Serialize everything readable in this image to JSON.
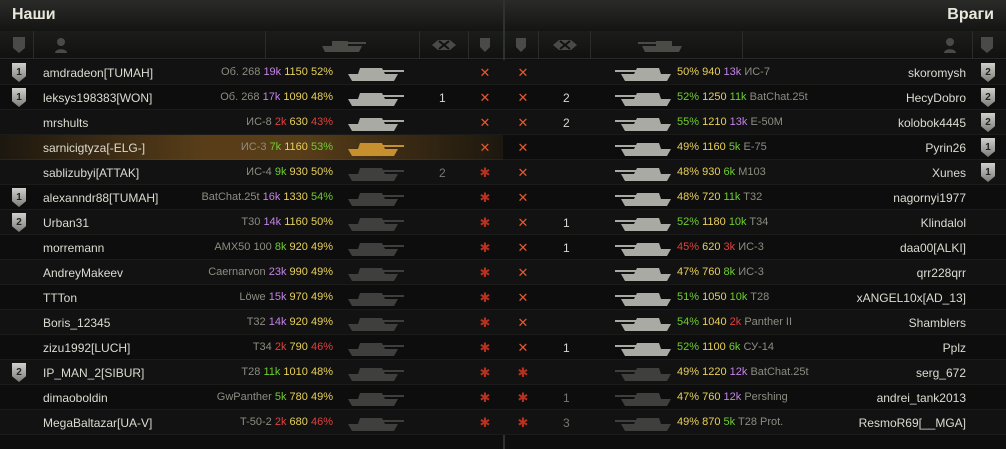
{
  "teams": {
    "left_title": "Наши",
    "right_title": "Враги"
  },
  "colors": {
    "win_green": "#6fce2f",
    "ok_yellow": "#e9d05a",
    "bad_red": "#e04040",
    "unicum_purple": "#c583e8",
    "highlight_gold": "#96642a"
  },
  "header_icons": [
    "badge-column-icon",
    "player-column-icon",
    "tank-column-icon",
    "frags-column-icon",
    "status-column-icon"
  ],
  "left": [
    {
      "badge": "1",
      "name": "amdradeon[TUMAH]",
      "tank": "Об. 268",
      "battles": "19k",
      "wn": "1150",
      "win": "52%",
      "bc": "c-purple",
      "wc": "c-yellow",
      "frags": "",
      "status": "x",
      "highlight": false,
      "dim": false
    },
    {
      "badge": "1",
      "name": "leksys198383[WON]",
      "tank": "Об. 268",
      "battles": "17k",
      "wn": "1090",
      "win": "48%",
      "bc": "c-purple",
      "wc": "c-yellow",
      "frags": "1",
      "status": "x",
      "highlight": false,
      "dim": false
    },
    {
      "badge": "",
      "name": "mrshults",
      "tank": "ИС-8",
      "battles": "2k",
      "wn": "630",
      "win": "43%",
      "bc": "c-red",
      "wc": "c-red",
      "frags": "",
      "status": "x",
      "highlight": false,
      "dim": false
    },
    {
      "badge": "",
      "name": "sarnicigtyza[-ELG-]",
      "tank": "ИС-3",
      "battles": "7k",
      "wn": "1160",
      "win": "53%",
      "bc": "c-green",
      "wc": "c-green",
      "frags": "",
      "status": "x",
      "highlight": true,
      "dim": false
    },
    {
      "badge": "",
      "name": "sablizubyi[ATTAK]",
      "tank": "ИС-4",
      "battles": "9k",
      "wn": "930",
      "win": "50%",
      "bc": "c-green",
      "wc": "c-yellow",
      "frags": "2",
      "status": "alive",
      "highlight": false,
      "dim": true
    },
    {
      "badge": "1",
      "name": "alexanndr88[TUMAH]",
      "tank": "BatChat.25t",
      "battles": "16k",
      "wn": "1330",
      "win": "54%",
      "bc": "c-purple",
      "wc": "c-green",
      "frags": "",
      "status": "alive",
      "highlight": false,
      "dim": false
    },
    {
      "badge": "2",
      "name": "Urban31",
      "tank": "T30",
      "battles": "14k",
      "wn": "1160",
      "win": "50%",
      "bc": "c-purple",
      "wc": "c-yellow",
      "frags": "",
      "status": "alive",
      "highlight": false,
      "dim": false
    },
    {
      "badge": "",
      "name": "morremann",
      "tank": "AMX50 100",
      "battles": "8k",
      "wn": "920",
      "win": "49%",
      "bc": "c-green",
      "wc": "c-yellow",
      "frags": "",
      "status": "alive",
      "highlight": false,
      "dim": false
    },
    {
      "badge": "",
      "name": "AndreyMakeev",
      "tank": "Caernarvon",
      "battles": "23k",
      "wn": "990",
      "win": "49%",
      "bc": "c-purple",
      "wc": "c-yellow",
      "frags": "",
      "status": "alive",
      "highlight": false,
      "dim": false
    },
    {
      "badge": "",
      "name": "TTTon",
      "tank": "Löwe",
      "battles": "15k",
      "wn": "970",
      "win": "49%",
      "bc": "c-purple",
      "wc": "c-yellow",
      "frags": "",
      "status": "alive",
      "highlight": false,
      "dim": false
    },
    {
      "badge": "",
      "name": "Boris_12345",
      "tank": "T32",
      "battles": "14k",
      "wn": "920",
      "win": "49%",
      "bc": "c-purple",
      "wc": "c-yellow",
      "frags": "",
      "status": "alive",
      "highlight": false,
      "dim": false
    },
    {
      "badge": "",
      "name": "zizu1992[LUCH]",
      "tank": "T34",
      "battles": "2k",
      "wn": "790",
      "win": "46%",
      "bc": "c-red",
      "wc": "c-red",
      "frags": "",
      "status": "alive",
      "highlight": false,
      "dim": false
    },
    {
      "badge": "2",
      "name": "IP_MAN_2[SIBUR]",
      "tank": "T28",
      "battles": "11k",
      "wn": "1010",
      "win": "48%",
      "bc": "c-green",
      "wc": "c-yellow",
      "frags": "",
      "status": "alive",
      "highlight": false,
      "dim": false
    },
    {
      "badge": "",
      "name": "dimaoboldin",
      "tank": "GwPanther",
      "battles": "5k",
      "wn": "780",
      "win": "49%",
      "bc": "c-green",
      "wc": "c-yellow",
      "frags": "",
      "status": "alive",
      "highlight": false,
      "dim": false
    },
    {
      "badge": "",
      "name": "MegaBaltazar[UA-V]",
      "tank": "T-50-2",
      "battles": "2k",
      "wn": "680",
      "win": "46%",
      "bc": "c-red",
      "wc": "c-red",
      "frags": "",
      "status": "alive",
      "highlight": false,
      "dim": false
    }
  ],
  "right": [
    {
      "badge": "2",
      "name": "skoromysh",
      "tank": "ИС-7",
      "battles": "13k",
      "wn": "940",
      "win": "50%",
      "bc": "c-purple",
      "wc": "c-yellow",
      "frags": "",
      "status": "x"
    },
    {
      "badge": "2",
      "name": "HecyDobro",
      "tank": "BatChat.25t",
      "battles": "11k",
      "wn": "1250",
      "win": "52%",
      "bc": "c-green",
      "wc": "c-green",
      "frags": "2",
      "status": "x"
    },
    {
      "badge": "2",
      "name": "kolobok4445",
      "tank": "E-50M",
      "battles": "13k",
      "wn": "1210",
      "win": "55%",
      "bc": "c-purple",
      "wc": "c-green",
      "frags": "2",
      "status": "x"
    },
    {
      "badge": "1",
      "name": "Pyrin26",
      "tank": "E-75",
      "battles": "5k",
      "wn": "1160",
      "win": "49%",
      "bc": "c-green",
      "wc": "c-yellow",
      "frags": "",
      "status": "x"
    },
    {
      "badge": "1",
      "name": "Xunes",
      "tank": "M103",
      "battles": "6k",
      "wn": "930",
      "win": "48%",
      "bc": "c-green",
      "wc": "c-yellow",
      "frags": "",
      "status": "x"
    },
    {
      "badge": "",
      "name": "nagornyi1977",
      "tank": "T32",
      "battles": "11k",
      "wn": "720",
      "win": "48%",
      "bc": "c-green",
      "wc": "c-yellow",
      "frags": "",
      "status": "x"
    },
    {
      "badge": "",
      "name": "Klindalol",
      "tank": "T34",
      "battles": "10k",
      "wn": "1180",
      "win": "52%",
      "bc": "c-green",
      "wc": "c-green",
      "frags": "1",
      "status": "x"
    },
    {
      "badge": "",
      "name": "daa00[ALKI]",
      "tank": "ИС-3",
      "battles": "3k",
      "wn": "620",
      "win": "45%",
      "bc": "c-red",
      "wc": "c-red",
      "frags": "1",
      "status": "x"
    },
    {
      "badge": "",
      "name": "qrr228qrr",
      "tank": "ИС-3",
      "battles": "8k",
      "wn": "760",
      "win": "47%",
      "bc": "c-green",
      "wc": "c-yellow",
      "frags": "",
      "status": "x"
    },
    {
      "badge": "",
      "name": "xANGEL10x[AD_13]",
      "tank": "T28",
      "battles": "10k",
      "wn": "1050",
      "win": "51%",
      "bc": "c-green",
      "wc": "c-green",
      "frags": "",
      "status": "x"
    },
    {
      "badge": "",
      "name": "Shamblers",
      "tank": "Panther II",
      "battles": "2k",
      "wn": "1040",
      "win": "54%",
      "bc": "c-red",
      "wc": "c-green",
      "frags": "",
      "status": "x"
    },
    {
      "badge": "",
      "name": "Pplz",
      "tank": "СУ-14",
      "battles": "6k",
      "wn": "1100",
      "win": "52%",
      "bc": "c-green",
      "wc": "c-green",
      "frags": "1",
      "status": "x"
    },
    {
      "badge": "",
      "name": "serg_672",
      "tank": "BatChat.25t",
      "battles": "12k",
      "wn": "1220",
      "win": "49%",
      "bc": "c-purple",
      "wc": "c-yellow",
      "frags": "",
      "status": "alive"
    },
    {
      "badge": "",
      "name": "andrei_tank2013",
      "tank": "Pershing",
      "battles": "12k",
      "wn": "760",
      "win": "47%",
      "bc": "c-purple",
      "wc": "c-yellow",
      "frags": "1",
      "status": "alive",
      "dimfrags": true
    },
    {
      "badge": "",
      "name": "ResmoR69[__MGA]",
      "tank": "T28 Prot.",
      "battles": "5k",
      "wn": "870",
      "win": "49%",
      "bc": "c-green",
      "wc": "c-yellow",
      "frags": "3",
      "status": "alive",
      "dimfrags": true
    }
  ]
}
